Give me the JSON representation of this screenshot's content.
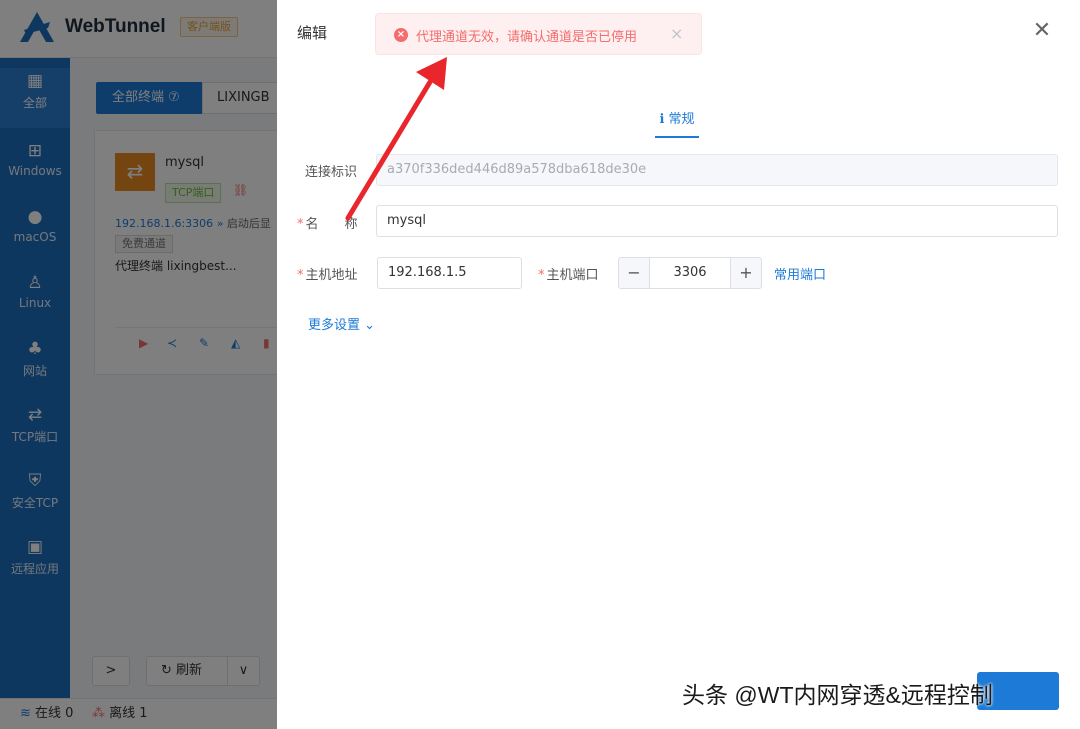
{
  "app": {
    "brand": "WebTunnel",
    "client_badge": "客户端版",
    "sidebar": [
      {
        "label": "全部",
        "icon": "grid-icon"
      },
      {
        "label": "Windows",
        "icon": "windows-icon"
      },
      {
        "label": "macOS",
        "icon": "apple-icon"
      },
      {
        "label": "Linux",
        "icon": "linux-icon"
      },
      {
        "label": "网站",
        "icon": "sitemap-icon"
      },
      {
        "label": "TCP端口",
        "icon": "exchange-icon"
      },
      {
        "label": "安全TCP",
        "icon": "secure-icon"
      },
      {
        "label": "远程应用",
        "icon": "remote-app-icon"
      }
    ],
    "tabs": {
      "all": "全部终端 ⑦",
      "other": "LIXINGB"
    },
    "card": {
      "name": "mysql",
      "tag": "TCP端口",
      "addr": "192.168.1.6:3306",
      "addr_arrow": "»",
      "addr_after": "启动后显",
      "free_tag": "免费通道",
      "desc": "代理终端 lixingbest..."
    },
    "footer": {
      "refresh_label": "刷新",
      "next": ">",
      "dropdown": "∨"
    },
    "status": {
      "online": "在线 0",
      "offline": "离线 1"
    }
  },
  "drawer": {
    "title": "编辑",
    "section_tab": "常规",
    "section_icon": "ℹ",
    "id_label": "连接标识",
    "id_value": "a370f336ded446d89a578dba618de30e",
    "name_label": "名　　称",
    "name_value": "mysql",
    "host_label": "主机地址",
    "host_value": "192.168.1.5",
    "port_label": "主机端口",
    "port_value": "3306",
    "port_minus": "−",
    "port_plus": "+",
    "common_ports": "常用端口",
    "more_settings": "更多设置 ⌄",
    "required_mark": "*"
  },
  "toast": {
    "message": "代理通道无效，请确认通道是否已停用",
    "icon": "error-icon"
  },
  "watermark": "头条 @WT内网穿透&远程控制",
  "colors": {
    "primary": "#1d7ad6",
    "sidebar": "#1d6fbf",
    "error": "#f56c6c",
    "annotation_arrow": "#e8262c"
  }
}
